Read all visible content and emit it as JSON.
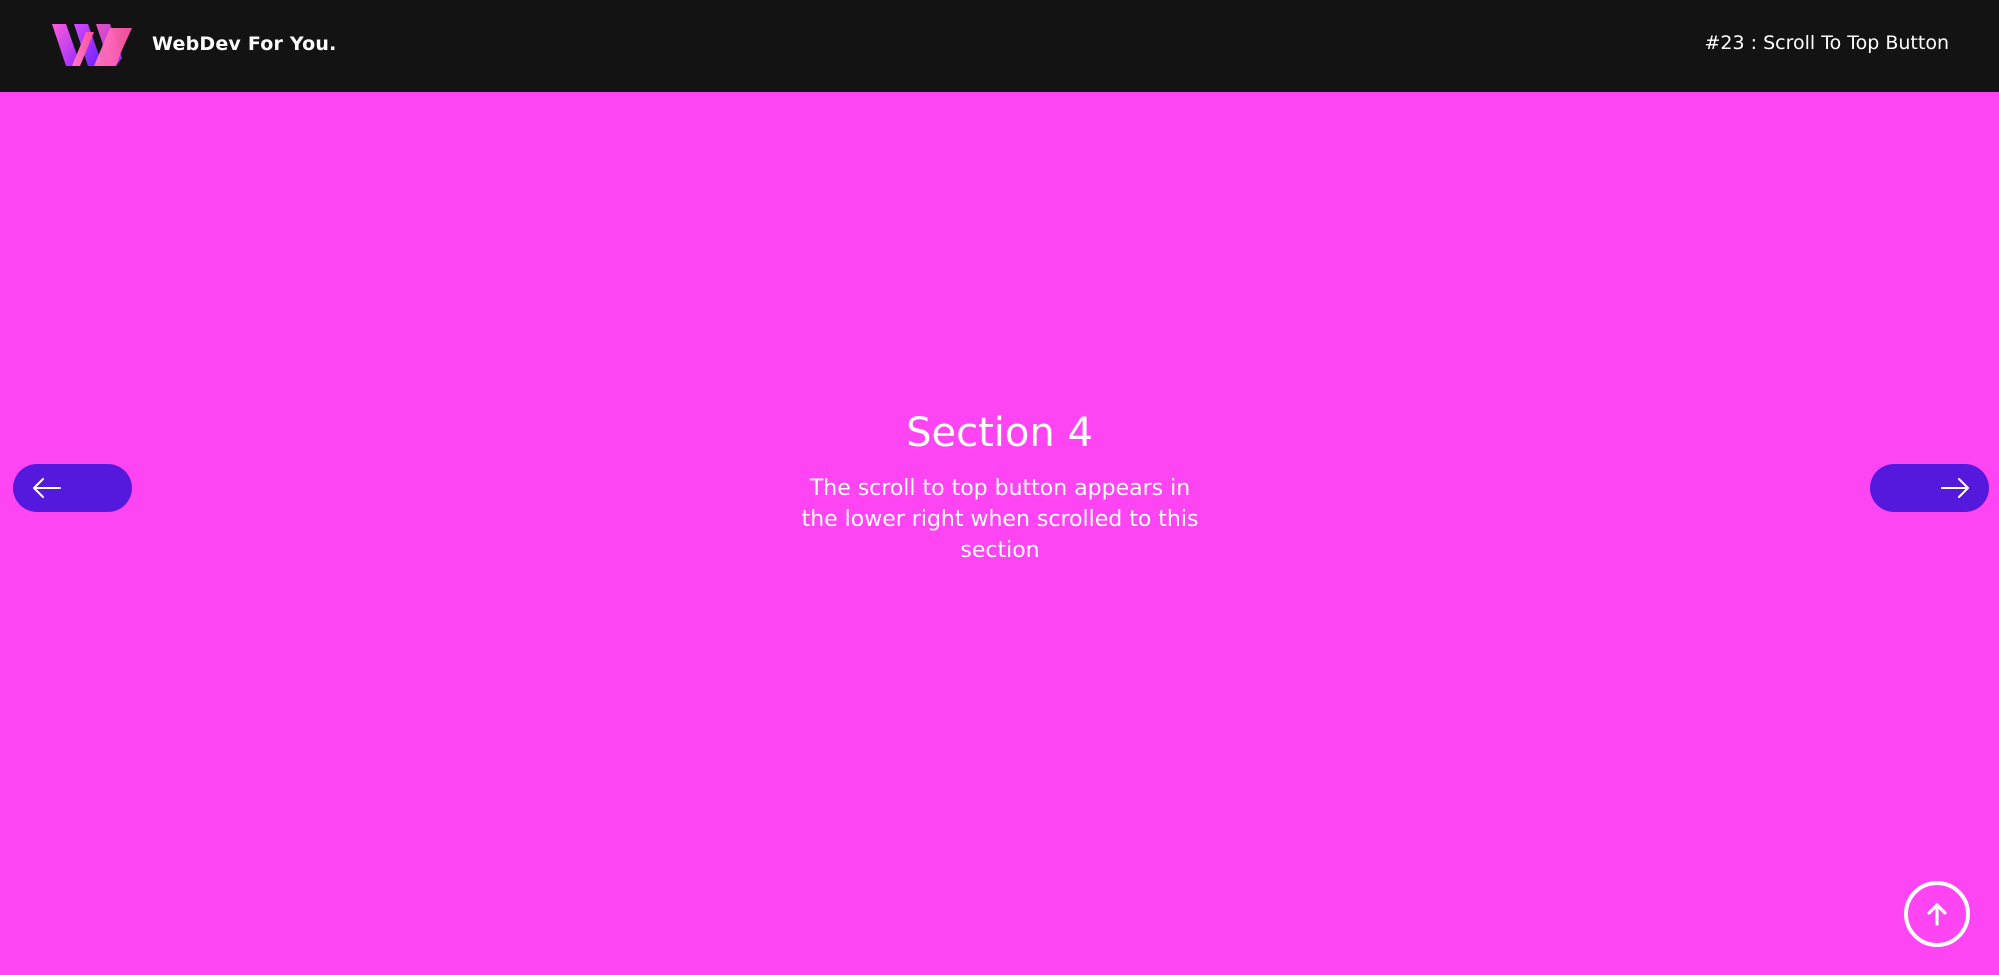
{
  "header": {
    "brand_name": "WebDev For You.",
    "page_tag": "#23 : Scroll To Top Button",
    "background": "#131313",
    "logo_icon": "w-logo-icon"
  },
  "section": {
    "title": "Section 4",
    "description": "The scroll to top button appears in the lower right when scrolled to this section",
    "background": "#ff44f4"
  },
  "nav": {
    "prev_icon": "arrow-left-icon",
    "next_icon": "arrow-right-icon",
    "color": "#5519dd"
  },
  "scroll_top": {
    "icon": "arrow-up-icon",
    "color": "#ffffff"
  }
}
